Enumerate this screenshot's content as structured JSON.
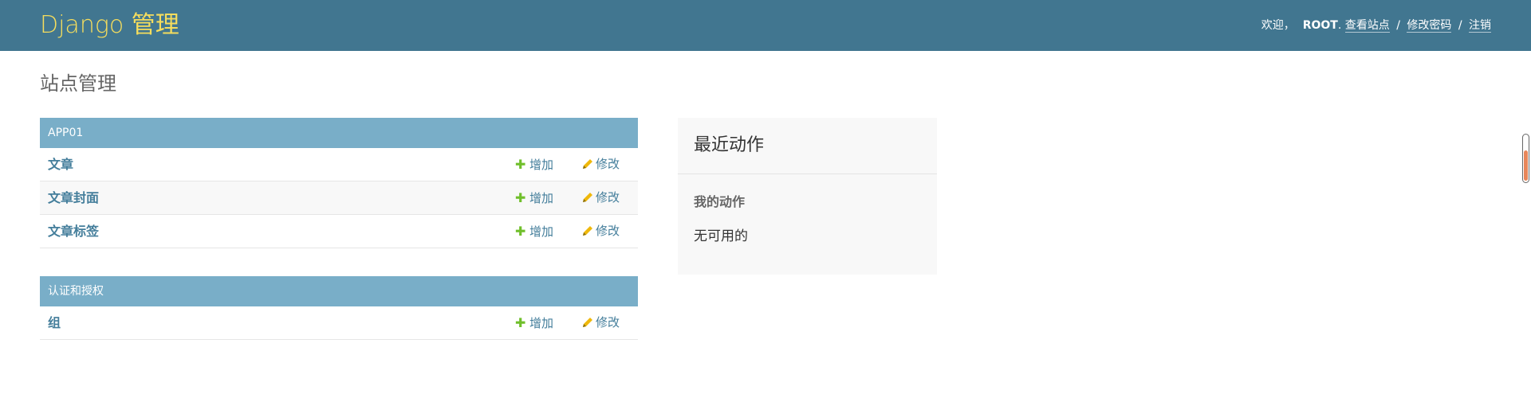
{
  "header": {
    "brand": "Django 管理",
    "welcome": "欢迎，",
    "user": "ROOT",
    "dot": ".",
    "view_site": "查看站点",
    "change_password": "修改密码",
    "logout": "注销",
    "separator": "/",
    "brand_color": "#f5dd5d",
    "bar_color": "#417690"
  },
  "page_title": "站点管理",
  "modules": [
    {
      "caption": "APP01",
      "rows": [
        {
          "model": "文章",
          "add": "增加",
          "change": "修改"
        },
        {
          "model": "文章封面",
          "add": "增加",
          "change": "修改"
        },
        {
          "model": "文章标签",
          "add": "增加",
          "change": "修改"
        }
      ]
    },
    {
      "caption": "认证和授权",
      "rows": [
        {
          "model": "组",
          "add": "增加",
          "change": "修改"
        }
      ]
    }
  ],
  "recent_actions": {
    "title": "最近动作",
    "my_actions": "我的动作",
    "empty": "无可用的"
  },
  "icons": {
    "add": "plus-icon",
    "change": "pencil-icon"
  }
}
